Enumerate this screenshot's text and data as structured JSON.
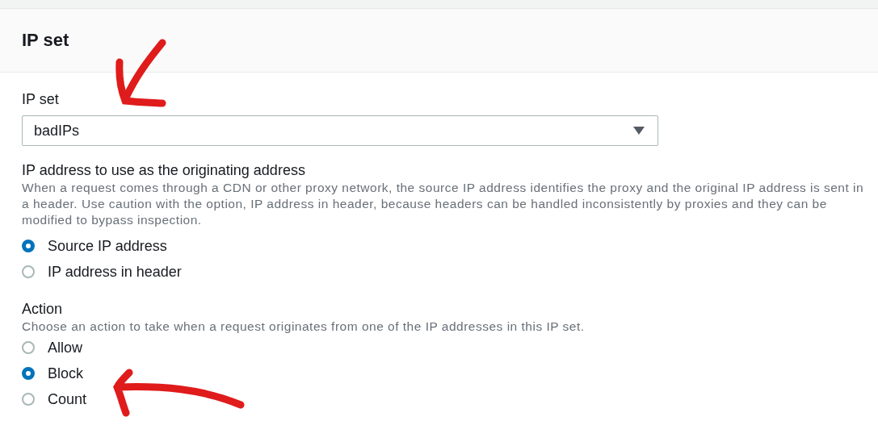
{
  "panel": {
    "title": "IP set"
  },
  "ip_set": {
    "label": "IP set",
    "value": "badIPs"
  },
  "originating_address": {
    "label": "IP address to use as the originating address",
    "description": "When a request comes through a CDN or other proxy network, the source IP address identifies the proxy and the original IP address is sent in a header. Use caution with the option, IP address in header, because headers can be handled inconsistently by proxies and they can be modified to bypass inspection.",
    "options": [
      {
        "label": "Source IP address",
        "selected": true
      },
      {
        "label": "IP address in header",
        "selected": false
      }
    ]
  },
  "action": {
    "label": "Action",
    "description": "Choose an action to take when a request originates from one of the IP addresses in this IP set.",
    "options": [
      {
        "label": "Allow",
        "selected": false
      },
      {
        "label": "Block",
        "selected": true
      },
      {
        "label": "Count",
        "selected": false
      }
    ]
  }
}
